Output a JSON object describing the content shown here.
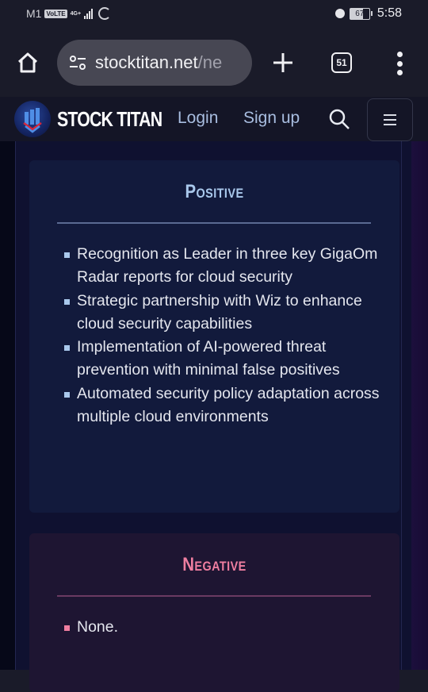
{
  "status_bar": {
    "carrier": "M1",
    "volte": "VoLTE",
    "network": "4G+",
    "battery_percent": "67",
    "time": "5:58"
  },
  "browser": {
    "url_domain": "stocktitan.net",
    "url_path": "/ne",
    "tab_count": "51",
    "icons": [
      "home-icon",
      "site-settings-icon",
      "new-tab-icon",
      "tab-switcher-icon",
      "more-menu-icon"
    ]
  },
  "site_header": {
    "brand": "STOCK TITAN",
    "login": "Login",
    "signup": "Sign up",
    "icons": [
      "logo-icon",
      "search-icon",
      "hamburger-menu-icon"
    ]
  },
  "positive": {
    "title": "Positive",
    "accent": "#a9c8ec",
    "items": [
      "Recognition as Leader in three key GigaOm Radar reports for cloud security",
      "Strategic partnership with Wiz to enhance cloud security capabilities",
      "Implementation of AI-powered threat prevention with minimal false positives",
      "Automated security policy adaptation across multiple cloud environments"
    ]
  },
  "negative": {
    "title": "Negative",
    "accent": "#ef7ea0",
    "items": [
      "None."
    ]
  }
}
